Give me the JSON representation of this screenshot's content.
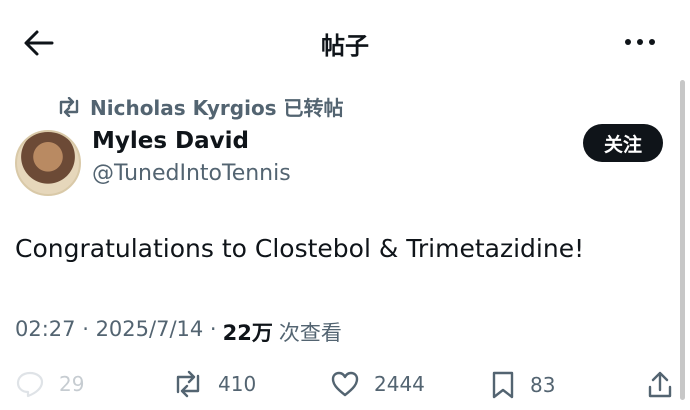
{
  "header": {
    "title": "帖子"
  },
  "repost": {
    "text": "Nicholas Kyrgios 已转帖"
  },
  "author": {
    "name": "Myles David",
    "handle": "@TunedIntoTennis",
    "follow_label": "关注"
  },
  "post": {
    "text": "Congratulations to Clostebol & Trimetazidine!"
  },
  "meta": {
    "time": "02:27",
    "date": "2025/7/14",
    "views": "22万",
    "views_label": "次查看"
  },
  "actions": {
    "replies": "29",
    "reposts": "410",
    "likes": "2444",
    "bookmarks": "83"
  },
  "colors": {
    "text": "#0f1419",
    "secondary": "#536471",
    "follow_bg": "#0f1419"
  }
}
